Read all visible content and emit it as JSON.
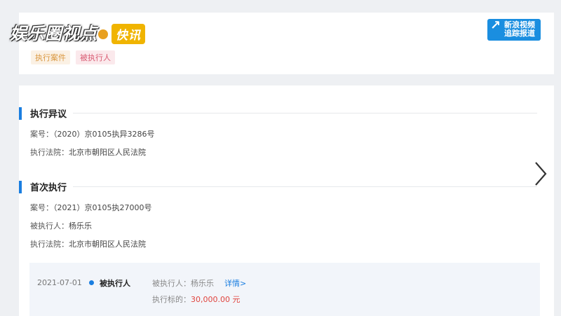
{
  "overlay": {
    "watermark_text": "娱乐圈视点",
    "badge": "快讯"
  },
  "logo": {
    "line1": "新浪视频",
    "line2": "追踪报道"
  },
  "tags": [
    {
      "label": "执行案件"
    },
    {
      "label": "被执行人"
    }
  ],
  "sections": [
    {
      "title": "执行异议",
      "rows": [
        {
          "label": "案号：",
          "value": "（2020）京0105执异3286号"
        },
        {
          "label": "执行法院：",
          "value": "北京市朝阳区人民法院"
        }
      ]
    },
    {
      "title": "首次执行",
      "rows": [
        {
          "label": "案号：",
          "value": "（2021）京0105执27000号"
        },
        {
          "label": "被执行人：",
          "value": "杨乐乐"
        },
        {
          "label": "执行法院：",
          "value": "北京市朝阳区人民法院"
        }
      ]
    }
  ],
  "record": {
    "date": "2021-07-01",
    "type": "被执行人",
    "person_label": "被执行人：",
    "person": "杨乐乐",
    "detail_link": "详情>",
    "amount_label": "执行标的：",
    "amount": "30,000.00 元"
  },
  "colors": {
    "accent": "#1a7ee0",
    "amount": "#e0443e",
    "tag_exec": "#d9963e",
    "tag_person": "#d95a72"
  },
  "icons": {
    "next": "chevron-right-icon"
  }
}
